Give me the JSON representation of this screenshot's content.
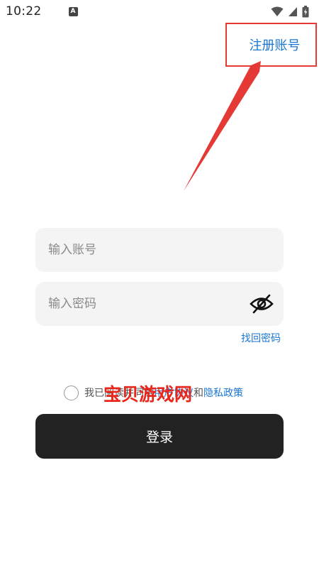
{
  "status_bar": {
    "time": "10:22",
    "notification_icon": "A",
    "icons": [
      "wifi-icon",
      "signal-icon",
      "battery-icon"
    ]
  },
  "header": {
    "register_label": "注册账号"
  },
  "form": {
    "account_placeholder": "输入账号",
    "account_value": "",
    "password_placeholder": "输入密码",
    "password_value": "",
    "password_toggle_icon": "eye-off-icon",
    "forgot_password_label": "找回密码"
  },
  "agreement": {
    "prefix": "我已阅读并同意",
    "user_agreement_label": "用户协议",
    "conjunction": "和",
    "privacy_policy_label": "隐私政策",
    "checked": false
  },
  "watermark": {
    "text": "宝贝游戏网"
  },
  "login_button_label": "登录",
  "colors": {
    "link": "#1976d2",
    "annotation_red": "#e53935",
    "button_bg": "#222222",
    "input_bg": "#f4f4f4"
  }
}
